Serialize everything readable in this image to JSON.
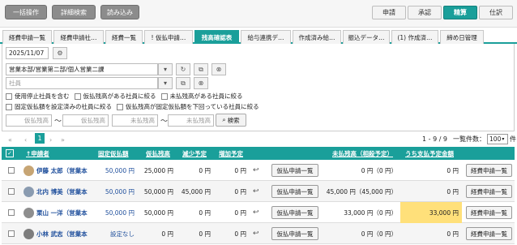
{
  "topbar": {
    "left_buttons": [
      "一括操作",
      "詳細検索",
      "読み込み"
    ],
    "mode_buttons": [
      "申請",
      "承認",
      "精算",
      "仕訳"
    ]
  },
  "tabs": [
    "経費申請一覧",
    "経費申請社…",
    "経費一覧",
    "! 仮払申請…",
    "残高確認表",
    "給与連携デ…",
    "作成済み給…",
    "振込データ…",
    "(1) 作成済…",
    "締め日管理"
  ],
  "filters": {
    "date": "2025/11/07",
    "department": "営業本部/営業第二部/個人営業二課",
    "employee_placeholder": "社員",
    "checkboxes": [
      "使用停止社員を含む",
      "仮払残高がある社員に絞る",
      "未払残高がある社員に絞る"
    ],
    "checkboxes2": [
      "固定仮払額を設定済みの社員に絞る",
      "仮払残高が固定仮払額を下回っている社員に絞る"
    ],
    "range1_placeholder": "仮払残高",
    "range2_placeholder": "未払残高",
    "search_label": "検索",
    "tilde": "〜"
  },
  "pager": {
    "first": "«",
    "prev": "‹",
    "page": "1",
    "next": "›",
    "last": "»",
    "range_text": "1 - 9 / 9",
    "per_page_label": "一覧件数：",
    "per_page_value": "100",
    "unit": "件"
  },
  "table": {
    "check_header": "✓",
    "headers": [
      "↑申請者",
      "固定仮払額",
      "仮払残高",
      "減少予定",
      "増加予定",
      "未払残高（相殺予定）",
      "うち支払予定金額"
    ],
    "button_advance": "仮払申請一覧",
    "button_expense": "経費申請一覧",
    "undo_icon": "↩",
    "rows": [
      {
        "name": "伊藤 太郎（営業本",
        "fixed": "50,000 円",
        "balance": "25,000 円",
        "decrease": "0 円",
        "increase": "0 円",
        "unpaid": "0 円（0 円）",
        "pay": "0 円",
        "highlight": false
      },
      {
        "name": "北内 博美（営業本",
        "fixed": "50,000 円",
        "balance": "50,000 円",
        "decrease": "45,000 円",
        "increase": "0 円",
        "unpaid": "45,000 円（45,000 円）",
        "pay": "0 円",
        "highlight": false
      },
      {
        "name": "栗山 一洋（営業本",
        "fixed": "50,000 円",
        "balance": "50,000 円",
        "decrease": "0 円",
        "increase": "0 円",
        "unpaid": "33,000 円（0 円）",
        "pay": "33,000 円",
        "highlight": true
      },
      {
        "name": "小林 武志（営業本",
        "fixed": "設定なし",
        "balance": "0 円",
        "decrease": "0 円",
        "increase": "0 円",
        "unpaid": "0 円（0 円）",
        "pay": "0 円",
        "highlight": false
      }
    ]
  },
  "colors": {
    "accent": "#1a9f9a",
    "highlight": "#ffe07a"
  }
}
